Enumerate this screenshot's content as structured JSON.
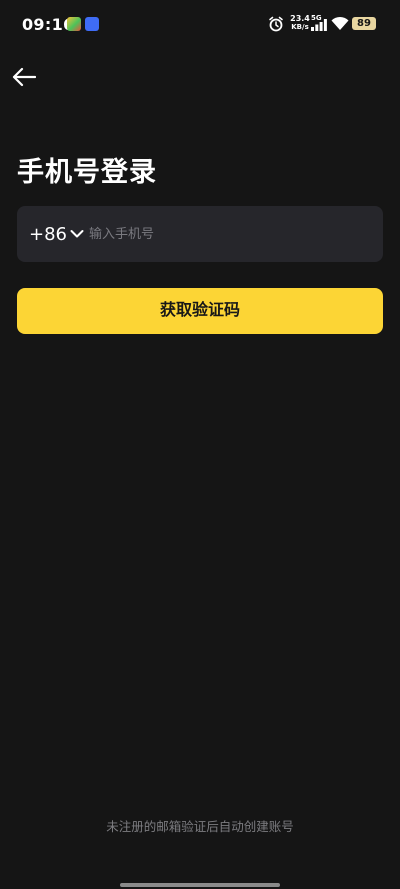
{
  "status_bar": {
    "time": "09:16",
    "net_speed_value": "23.4",
    "net_speed_unit": "KB/s",
    "network_type": "5G",
    "battery": "89"
  },
  "page": {
    "title": "手机号登录"
  },
  "phone": {
    "country_code": "+86",
    "placeholder": "输入手机号",
    "value": ""
  },
  "actions": {
    "get_code_label": "获取验证码"
  },
  "footer": {
    "note": "未注册的邮箱验证后自动创建账号"
  },
  "colors": {
    "background": "#151515",
    "field": "#26262b",
    "accent": "#fcd535"
  },
  "icons": [
    "back-arrow-icon",
    "chevron-down-icon",
    "alarm-icon",
    "signal-icon",
    "wifi-icon"
  ]
}
